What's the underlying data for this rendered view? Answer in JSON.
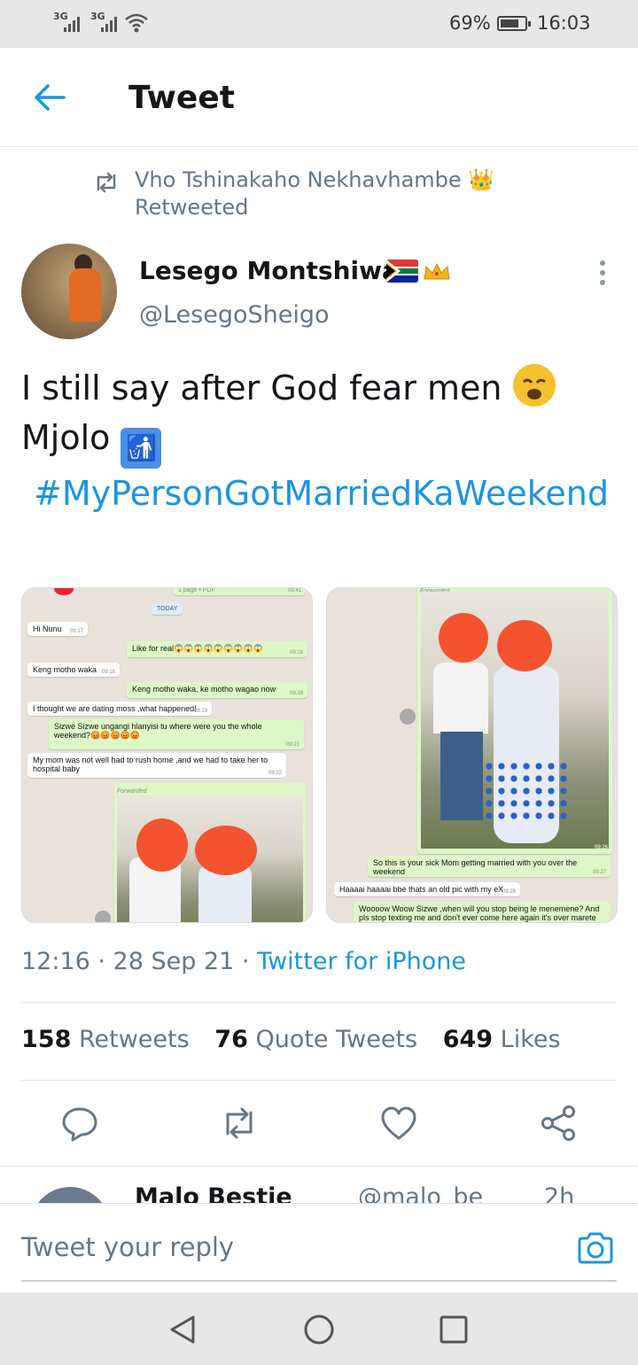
{
  "status_bar": {
    "network_1": "3G",
    "network_2": "3G",
    "battery": "69%",
    "time": "16:03"
  },
  "header": {
    "title": "Tweet"
  },
  "retweet_context": {
    "text": "Vho Tshinakaho Nekhavhambe 👑 Retweeted"
  },
  "tweet": {
    "author_name": "Lesego Montshiwa",
    "author_handle": "@LesegoSheigo",
    "text_line1": "I still say after God fear men ",
    "text_line2": "Mjolo ",
    "hashtag": "#MyPersonGotMarriedKaWeekend",
    "timestamp": "12:16 · 28 Sep 21 · ",
    "source": "Twitter for iPhone",
    "retweets_count": "158",
    "retweets_label": "Retweets",
    "quotes_count": "76",
    "quotes_label": "Quote Tweets",
    "likes_count": "649",
    "likes_label": "Likes"
  },
  "media_left": {
    "top_label": "1 page • PDF",
    "top_time": "09:41",
    "date_chip": "TODAY",
    "messages": [
      {
        "text": "Hi Nunu",
        "time": "09:17"
      },
      {
        "text": "Like for real😱😱😱😱😱😱😱😱😱",
        "time": "09:18"
      },
      {
        "text": "Keng motho waka",
        "time": "09:18"
      },
      {
        "text": "Keng motho waka,  ke motho wagao now",
        "time": "09:19"
      },
      {
        "text": "I thought we are dating moss ,what happened!",
        "time": "09:19"
      },
      {
        "text": "Sizwe  Sizwe ungangi hlanyisi tu where were you the whole weekend?😡😡😡😡😡",
        "time": "09:21"
      },
      {
        "text": "My mom was not well had to rush home ,and we had to take her to hospital baby",
        "time": "09:22"
      }
    ],
    "forwarded_label": "Forwarded"
  },
  "media_right": {
    "forwarded_label": "Forwarded",
    "photo_time": "09:26",
    "messages": [
      {
        "text": "So this is your sick Mom getting  married with you over the weekend",
        "time": "09:27"
      },
      {
        "text": "Haaaai haaaai bbe thats an old pic with my eX",
        "time": "09:28"
      },
      {
        "text": "Woooow Woow Sizwe ,when will you stop being le menemene? And pls stop texting  me and don't ever come here again it's  over marete astlaela",
        "time": ""
      }
    ]
  },
  "next_tweet": {
    "name": "Malo Bestie",
    "handle": "@malo_be",
    "time": "2h"
  },
  "reply": {
    "placeholder": "Tweet your reply"
  },
  "icons": {
    "back": "back-arrow-icon",
    "retweet_context": "retweet-icon",
    "more": "more-vertical-icon",
    "reply": "reply-icon",
    "retweet": "retweet-icon",
    "like": "heart-icon",
    "share": "share-icon",
    "camera": "camera-icon",
    "nav_back": "nav-back-icon",
    "nav_home": "nav-home-icon",
    "nav_recents": "nav-recents-icon"
  },
  "colors": {
    "accent": "#1b95e0",
    "secondary_text": "#657786",
    "primary_text": "#14171a"
  }
}
